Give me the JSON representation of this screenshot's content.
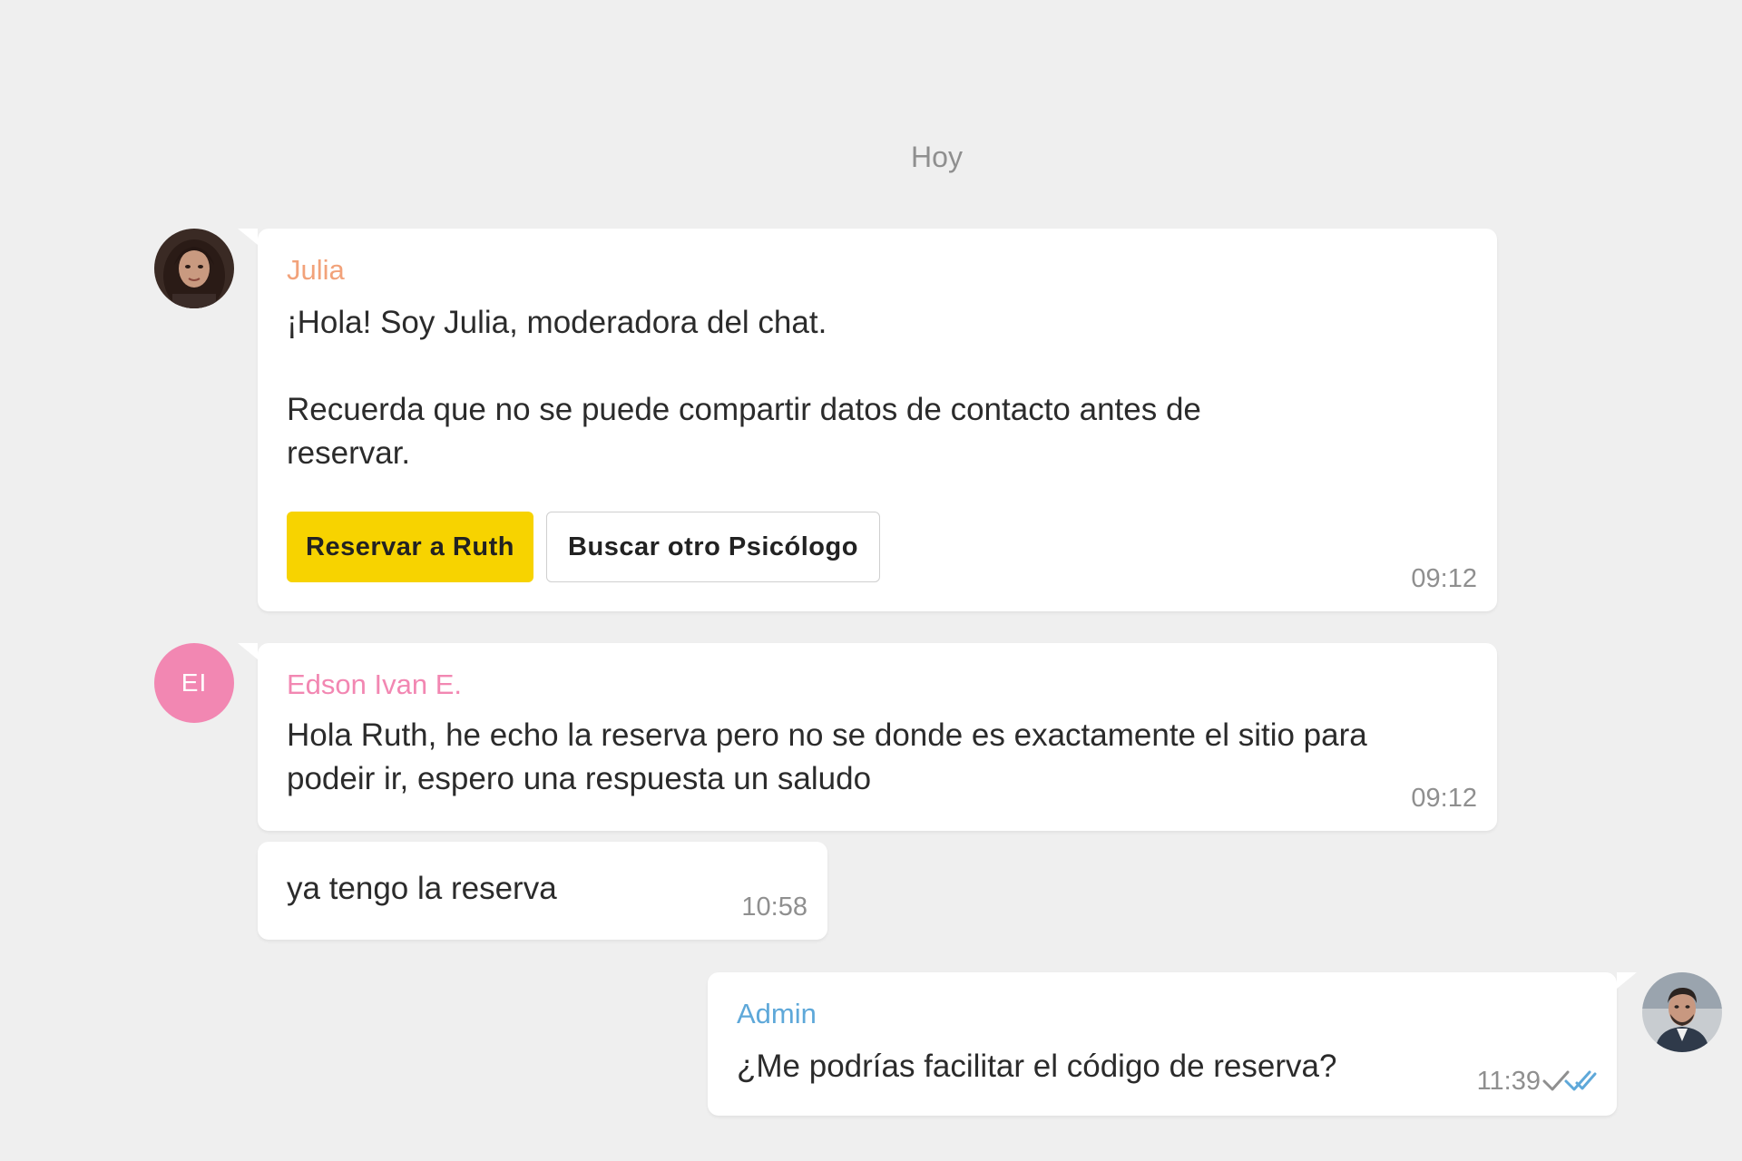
{
  "chat": {
    "date_separator": "Hoy",
    "messages": [
      {
        "sender": "Julia",
        "sender_color": "#f2a27a",
        "text": "¡Hola! Soy Julia, moderadora del chat.\n\nRecuerda que no se puede compartir datos de contacto antes de\nreservar.",
        "time": "09:12",
        "actions": {
          "primary_label": "Reservar a Ruth",
          "secondary_label": "Buscar otro Psicólogo"
        }
      },
      {
        "sender": "Edson Ivan E.",
        "sender_initials": "EI",
        "sender_color": "#f287b2",
        "text": "Hola Ruth, he echo la reserva pero no se donde es exactamente el sitio para\npodeir ir, espero una respuesta un saludo",
        "time": "09:12"
      },
      {
        "text": "ya tengo la reserva",
        "time": "10:58"
      },
      {
        "sender": "Admin",
        "sender_color": "#5ea8d9",
        "text": "¿Me podrías facilitar el código de reserva?",
        "time": "11:39",
        "status_icon": "double-check-icon"
      }
    ]
  },
  "colors": {
    "background": "#efefef",
    "bubble": "#ffffff",
    "primary_button": "#f7d300",
    "read_tick": "#5ea8d9"
  }
}
